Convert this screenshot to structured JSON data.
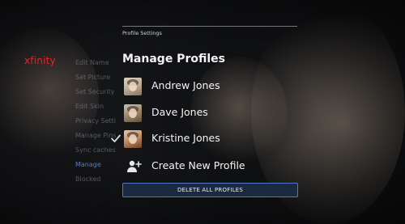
{
  "logo": {
    "text": "xfinity",
    "color": "#e2242b"
  },
  "menu": {
    "items": [
      {
        "label": "Edit Name"
      },
      {
        "label": "Set Picture"
      },
      {
        "label": "Set Security"
      },
      {
        "label": "Edit Skin"
      },
      {
        "label": "Privacy Settings"
      },
      {
        "label": "Manage Pins"
      },
      {
        "label": "Sync caches"
      },
      {
        "label": "Manage"
      },
      {
        "label": "Blocked"
      }
    ],
    "active_index": 7
  },
  "panel": {
    "breadcrumb": "Profile Settings",
    "title": "Manage Profiles",
    "profiles": [
      {
        "name": "Andrew Jones",
        "selected": false,
        "avatar": "avatar-andrew"
      },
      {
        "name": "Dave Jones",
        "selected": false,
        "avatar": "avatar-dave"
      },
      {
        "name": "Kristine Jones",
        "selected": true,
        "avatar": "avatar-kristine"
      }
    ],
    "create": {
      "label": "Create New Profile",
      "icon": "add-user-icon"
    },
    "delete_all": {
      "label": "DELETE ALL PROFILES"
    },
    "accent": "#4f78c4"
  }
}
